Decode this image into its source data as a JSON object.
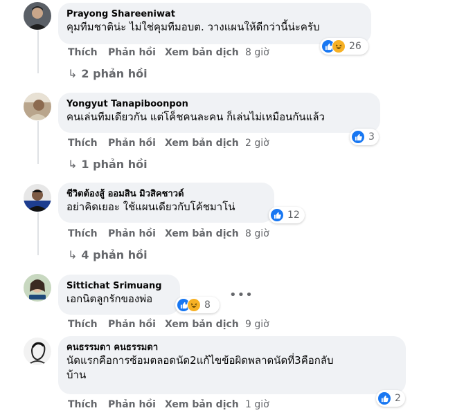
{
  "comments": [
    {
      "author": "Prayong Shareeniwat",
      "text": "คุมทีมชาติน่ะ ไม่ใช่คุมทีมอบต. วางแผนให้ดีกว่านี้น่ะครับ",
      "actions": {
        "like": "Thích",
        "reply": "Phản hồi",
        "translate": "Xem bản dịch",
        "time": "8 giờ"
      },
      "reactions": {
        "icons": [
          "like-icon",
          "haha-icon"
        ],
        "count": "26"
      },
      "replies": "2 phản hồi"
    },
    {
      "author": "Yongyut Tanapiboonpon",
      "text": "คนเล่นทีมเดียวกัน แต่โค็ชคนละคน ก็เล่นไม่เหมือนกันแล้ว",
      "actions": {
        "like": "Thích",
        "reply": "Phản hồi",
        "translate": "Xem bản dịch",
        "time": "2 giờ"
      },
      "reactions": {
        "icons": [
          "like-icon"
        ],
        "count": "3"
      },
      "replies": "1 phản hồi"
    },
    {
      "author": "ชีวิตต้องสู้ ออมสิน มิวสิคชาวด์",
      "text": "อย่าคิดเยอะ ใช้แผนเดียวกับโค้ชมาโน่",
      "actions": {
        "like": "Thích",
        "reply": "Phản hồi",
        "translate": "Xem bản dịch",
        "time": "8 giờ"
      },
      "reactions": {
        "icons": [
          "like-icon"
        ],
        "count": "12"
      },
      "replies": "4 phản hồi"
    },
    {
      "author": "Sittichat Srimuang",
      "text": "เอกนิตลูกรักของพ่อ",
      "actions": {
        "like": "Thích",
        "reply": "Phản hồi",
        "translate": "Xem bản dịch",
        "time": "9 giờ"
      },
      "reactions": {
        "icons": [
          "like-icon",
          "haha-icon"
        ],
        "count": "8"
      },
      "more": "•••"
    },
    {
      "author": "คนธรรมดา คนธรรมดา",
      "text_line1": "นัดแรกคือการซ้อมตลอดนัด2แก้ไขข้อผิดพลาดนัดที่3คือกลับ",
      "text_line2": "บ้าน",
      "actions": {
        "like": "Thích",
        "reply": "Phản hồi",
        "translate": "Xem bản dịch",
        "time": "1 giờ"
      },
      "reactions": {
        "icons": [
          "like-icon"
        ],
        "count": "2"
      }
    }
  ],
  "colors": {
    "bubble": "#f0f2f5",
    "secondary_text": "#65676b",
    "like_blue": "#1877f2",
    "haha_yellow": "#f7b125"
  }
}
